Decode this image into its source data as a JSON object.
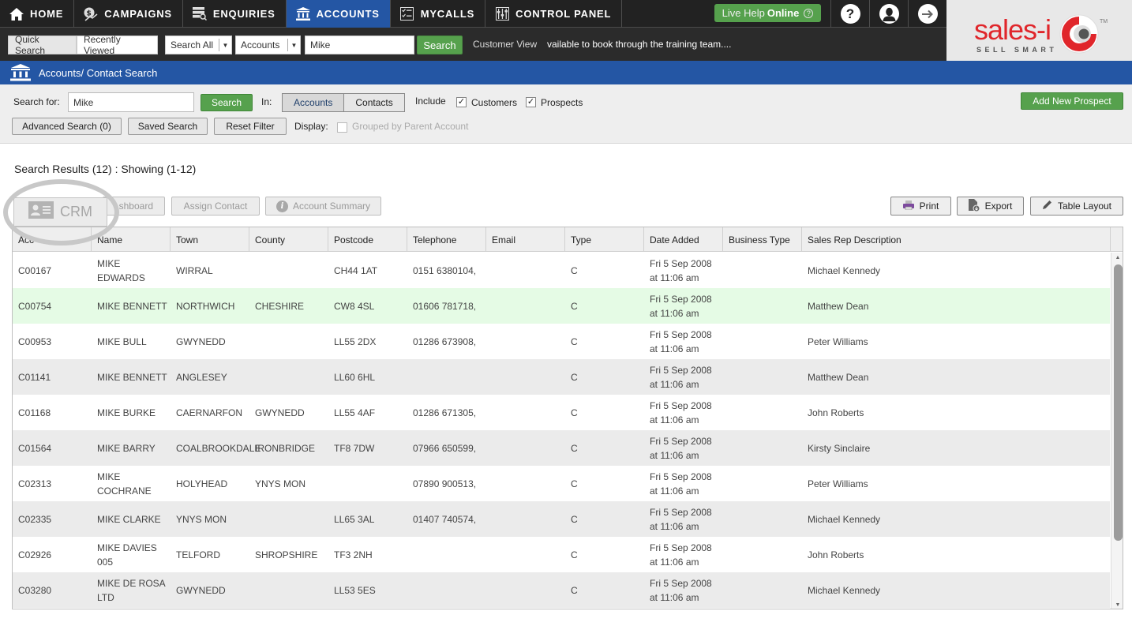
{
  "nav": {
    "items": [
      {
        "label": "HOME",
        "icon": "home-icon"
      },
      {
        "label": "CAMPAIGNS",
        "icon": "campaigns-icon"
      },
      {
        "label": "ENQUIRIES",
        "icon": "enquiries-icon"
      },
      {
        "label": "ACCOUNTS",
        "icon": "accounts-icon",
        "active": true
      },
      {
        "label": "MYCALLS",
        "icon": "mycalls-icon"
      },
      {
        "label": "CONTROL PANEL",
        "icon": "control-panel-icon"
      }
    ],
    "live_help_prefix": "Live Help",
    "live_help_status": "Online",
    "live_help_q": "?",
    "help_icon_glyph": "?",
    "brand_accent": "#2456a4",
    "green": "#56a14d"
  },
  "quickbar": {
    "quick_search": "Quick Search",
    "recently_viewed": "Recently Viewed",
    "scope_select": "Search All",
    "type_select": "Accounts",
    "query": "Mike",
    "search_label": "Search",
    "customer_view": "Customer View",
    "ticker": "vailable to book through the training team...."
  },
  "logo": {
    "word": "sales-i",
    "tagline": "SELL SMART",
    "tm": "TM"
  },
  "page": {
    "title": "Accounts/ Contact Search"
  },
  "filter": {
    "search_for_label": "Search for:",
    "search_value": "Mike",
    "search_button": "Search",
    "in_label": "In:",
    "in_options": [
      "Accounts",
      "Contacts"
    ],
    "in_selected": "Accounts",
    "include_label": "Include",
    "customers_label": "Customers",
    "customers_checked": true,
    "prospects_label": "Prospects",
    "prospects_checked": true,
    "advanced_search": "Advanced Search (0)",
    "saved_search": "Saved Search",
    "reset_filter": "Reset Filter",
    "display_label": "Display:",
    "grouped_label": "Grouped by Parent Account",
    "grouped_checked": false,
    "add_new_prospect": "Add New Prospect"
  },
  "results": {
    "title": "Search Results (12) : Showing (1-12)",
    "actions": {
      "crm": "CRM",
      "dashboard": "Dashboard",
      "dashboard_visible": "shboard",
      "assign_contact": "Assign Contact",
      "account_summary": "Account Summary",
      "print": "Print",
      "export": "Export",
      "table_layout": "Table Layout"
    },
    "columns": [
      "Account",
      "Name",
      "Town",
      "County",
      "Postcode",
      "Telephone",
      "Email",
      "Type",
      "Date Added",
      "Business Type",
      "Sales Rep Description"
    ],
    "columns_visible": [
      "Acc",
      "Name",
      "Town",
      "County",
      "Postcode",
      "Telephone",
      "Email",
      "Type",
      "Date Added",
      "Business Type",
      "Sales Rep Description"
    ],
    "rows": [
      {
        "account": "C00167",
        "name": "MIKE EDWARDS",
        "town": "WIRRAL",
        "county": "",
        "postcode": "CH44 1AT",
        "telephone": "0151 6380104,",
        "email": "",
        "type": "C",
        "date_added": "Fri 5 Sep 2008 at 11:06 am",
        "business_type": "",
        "sales_rep": "Michael Kennedy"
      },
      {
        "account": "C00754",
        "name": "MIKE BENNETT",
        "town": "NORTHWICH",
        "county": "CHESHIRE",
        "postcode": "CW8 4SL",
        "telephone": "01606 781718,",
        "email": "",
        "type": "C",
        "date_added": "Fri 5 Sep 2008 at 11:06 am",
        "business_type": "",
        "sales_rep": "Matthew Dean",
        "highlighted": true
      },
      {
        "account": "C00953",
        "name": "MIKE BULL",
        "town": "GWYNEDD",
        "county": "",
        "postcode": "LL55 2DX",
        "telephone": "01286 673908,",
        "email": "",
        "type": "C",
        "date_added": "Fri 5 Sep 2008 at 11:06 am",
        "business_type": "",
        "sales_rep": "Peter Williams"
      },
      {
        "account": "C01141",
        "name": "MIKE  BENNETT",
        "town": "ANGLESEY",
        "county": "",
        "postcode": "LL60 6HL",
        "telephone": "",
        "email": "",
        "type": "C",
        "date_added": "Fri 5 Sep 2008 at 11:06 am",
        "business_type": "",
        "sales_rep": "Matthew Dean"
      },
      {
        "account": "C01168",
        "name": "MIKE BURKE",
        "town": "CAERNARFON",
        "county": "GWYNEDD",
        "postcode": "LL55 4AF",
        "telephone": "01286 671305,",
        "email": "",
        "type": "C",
        "date_added": "Fri 5 Sep 2008 at 11:06 am",
        "business_type": "",
        "sales_rep": "John Roberts"
      },
      {
        "account": "C01564",
        "name": "MIKE BARRY",
        "town": "COALBROOKDALE",
        "county": "IRONBRIDGE",
        "postcode": "TF8 7DW",
        "telephone": "07966 650599,",
        "email": "",
        "type": "C",
        "date_added": "Fri 5 Sep 2008 at 11:06 am",
        "business_type": "",
        "sales_rep": "Kirsty Sinclaire"
      },
      {
        "account": "C02313",
        "name": "MIKE COCHRANE",
        "town": "HOLYHEAD",
        "county": "YNYS MON",
        "postcode": "",
        "telephone": "07890 900513,",
        "email": "",
        "type": "C",
        "date_added": "Fri 5 Sep 2008 at 11:06 am",
        "business_type": "",
        "sales_rep": "Peter Williams"
      },
      {
        "account": "C02335",
        "name": "MIKE CLARKE",
        "town": "YNYS MON",
        "county": "",
        "postcode": "LL65 3AL",
        "telephone": "01407 740574,",
        "email": "",
        "type": "C",
        "date_added": "Fri 5 Sep 2008 at 11:06 am",
        "business_type": "",
        "sales_rep": "Michael Kennedy"
      },
      {
        "account": "C02926",
        "name": "MIKE DAVIES 005",
        "town": "TELFORD",
        "county": "SHROPSHIRE",
        "postcode": "TF3 2NH",
        "telephone": "",
        "email": "",
        "type": "C",
        "date_added": "Fri 5 Sep 2008 at 11:06 am",
        "business_type": "",
        "sales_rep": "John Roberts"
      },
      {
        "account": "C03280",
        "name": "MIKE DE ROSA LTD",
        "town": "GWYNEDD",
        "county": "",
        "postcode": "LL53 5ES",
        "telephone": "",
        "email": "",
        "type": "C",
        "date_added": "Fri 5 Sep 2008 at 11:06 am",
        "business_type": "",
        "sales_rep": "Michael Kennedy"
      }
    ]
  }
}
